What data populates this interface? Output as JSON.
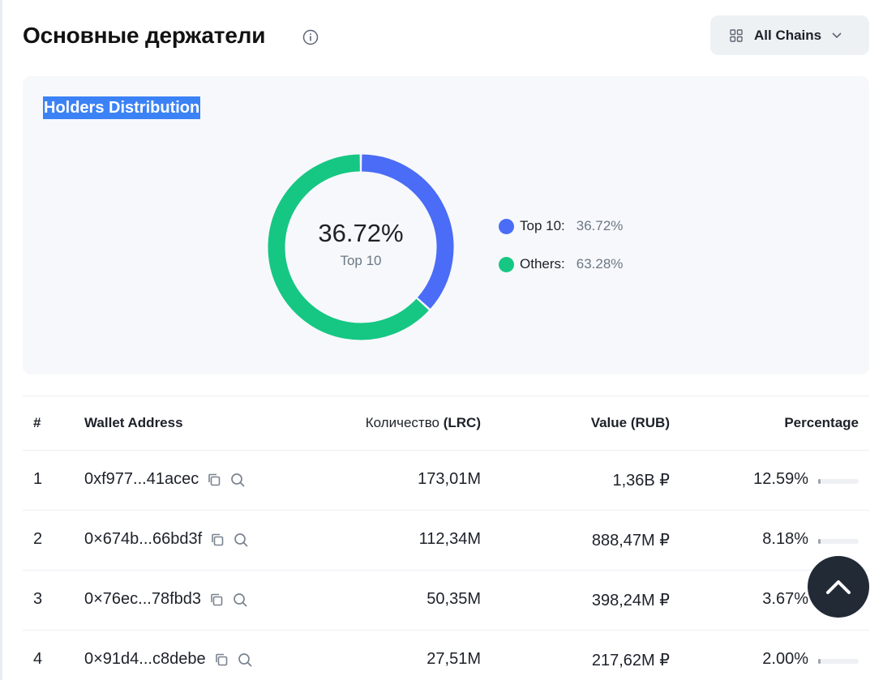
{
  "header": {
    "title": "Основные держатели",
    "chain_selector": {
      "label": "All Chains"
    }
  },
  "distribution": {
    "title": "Holders Distribution",
    "center_value": "36.72%",
    "center_label": "Top 10",
    "segments": [
      {
        "label": "Top 10:",
        "value": "36.72%",
        "fraction": 0.3672,
        "color": "#4a6cf7"
      },
      {
        "label": "Others:",
        "value": "63.28%",
        "fraction": 0.6328,
        "color": "#16c784"
      }
    ]
  },
  "table": {
    "columns": {
      "index": "#",
      "address": "Wallet Address",
      "amount_prefix": "Количество",
      "amount_unit": "(LRC)",
      "value": "Value (RUB)",
      "percentage": "Percentage"
    },
    "rows": [
      {
        "index": "1",
        "address": "0xf977...41acec",
        "amount": "173,01M",
        "value": "1,36B ₽",
        "percentage": "12.59%",
        "share": 0.1259
      },
      {
        "index": "2",
        "address": "0×674b...66bd3f",
        "amount": "112,34M",
        "value": "888,47M ₽",
        "percentage": "8.18%",
        "share": 0.0818
      },
      {
        "index": "3",
        "address": "0×76ec...78fbd3",
        "amount": "50,35M",
        "value": "398,24M ₽",
        "percentage": "3.67%",
        "share": 0.0367
      },
      {
        "index": "4",
        "address": "0×91d4...c8debe",
        "amount": "27,51M",
        "value": "217,62M ₽",
        "percentage": "2.00%",
        "share": 0.02
      }
    ]
  },
  "icons": {
    "info": "info-icon",
    "chain": "grid-icon",
    "copy": "copy-icon",
    "search": "search-icon",
    "scroll_top": "chevron-up-icon"
  }
}
